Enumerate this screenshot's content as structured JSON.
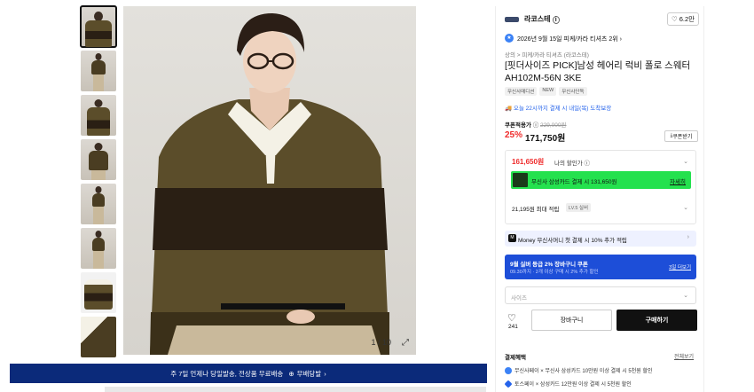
{
  "gallery": {
    "counter": "1 / 10",
    "thumbnail_count": 8
  },
  "banner": {
    "text": "주 7일 언제나 당일발송, 전상품 무료배송",
    "tag": "무배당발"
  },
  "product": {
    "brand": "라코스테",
    "likes": "6.2만",
    "rank": "2026년 9월 15일 피케/카라 티셔츠 2위",
    "breadcrumb": "상의 > 피케/카라 티셔츠 (라코스테)",
    "title": "[핏더사이즈 PICK]남성 헤어리 럭비 폴로 스웨터 AH102M-56N 3KE",
    "badges": [
      "무신사매디션",
      "NEW",
      "무신사단독"
    ],
    "delivery": "오늘 22시까지 결제 시 내일(목) 도착보장",
    "coupon_label": "쿠폰적용가",
    "original_price": "229,000원",
    "discount": "25%",
    "price": "171,750원",
    "coupon_button": "쿠폰받기"
  },
  "sale": {
    "price": "161,650원",
    "label": "나의 할인가",
    "card_text": "무신사 삼성카드 결제 시 131,650원",
    "card_link": "자세히",
    "points": "21,195원 최대 적립",
    "level": "LV.5 실버"
  },
  "money": {
    "text": "Money 무신사머니 첫 결제 시 10% 추가 적립"
  },
  "promo": {
    "title": "9월 실버 등급 2% 장바구니 쿠폰",
    "subtitle": "09.30까지 · 2개 이상 구매 시 2% 추가 할인",
    "link": "3일 더보기"
  },
  "size": {
    "placeholder": "사이즈"
  },
  "actions": {
    "like_count": "241",
    "cart": "장바구니",
    "buy": "구매하기"
  },
  "benefits": {
    "title": "결제혜택",
    "all": "전체보기",
    "items": [
      "무신사페이 × 무신사 삼성카드 10만원 이상 결제 시 5천원 할인",
      "토스페이 × 삼성카드 12만원 이상 결제 시 5천원 할인"
    ]
  },
  "colors": {
    "accent_red": "#ef2b2b",
    "banner_blue": "#0b2a7a",
    "promo_blue": "#1d4ed8",
    "card_green": "#24e14e"
  }
}
